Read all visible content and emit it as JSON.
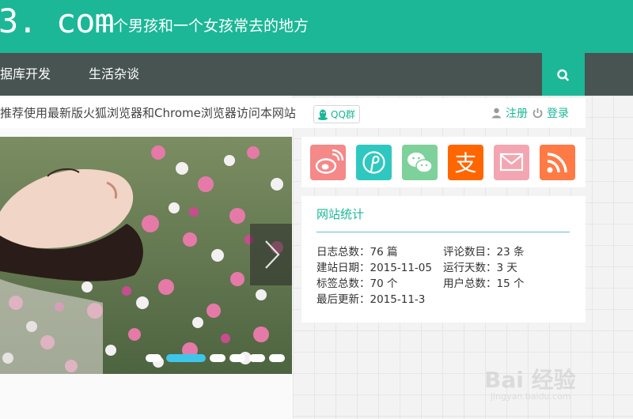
{
  "header": {
    "logo_domain": "3. com",
    "slogan": "一个男孩和一个女孩常去的地方",
    "brand_color": "#1bb797"
  },
  "nav": {
    "items": [
      {
        "label": "数据库开发"
      },
      {
        "label": "生活杂谈"
      }
    ],
    "bg_color": "#475452",
    "search_icon": "search-icon"
  },
  "notice": {
    "text": "推荐使用最新版火狐浏览器和Chrome浏览器访问本网站",
    "qq_label": "QQ群",
    "register_label": "注册",
    "login_label": "登录"
  },
  "slider": {
    "image_desc": "woman-lying-in-flowers-photo",
    "dot_count": 6,
    "active_dot": 1,
    "next_icon": "chevron-right-icon"
  },
  "social": {
    "items": [
      {
        "name": "weibo",
        "color": "#f58888"
      },
      {
        "name": "pinterest",
        "color": "#2ec8c0"
      },
      {
        "name": "wechat",
        "color": "#7ed19b"
      },
      {
        "name": "alipay",
        "color": "#ff6600",
        "glyph": "支"
      },
      {
        "name": "email",
        "color": "#f3a6b1"
      },
      {
        "name": "rss",
        "color": "#ff7a45"
      }
    ]
  },
  "stats": {
    "title": "网站统计",
    "rows": [
      {
        "left": "日志总数：76 篇",
        "right": "评论数目：23 条"
      },
      {
        "left": "建站日期：2015-11-05",
        "right": "运行天数：3 天"
      },
      {
        "left": "标签总数：70 个",
        "right": "用户总数：15 个"
      },
      {
        "left": "最后更新：2015-11-3",
        "right": ""
      }
    ]
  },
  "watermark": {
    "text": "Bai 经验",
    "url": "jingyan.baidu.com"
  }
}
